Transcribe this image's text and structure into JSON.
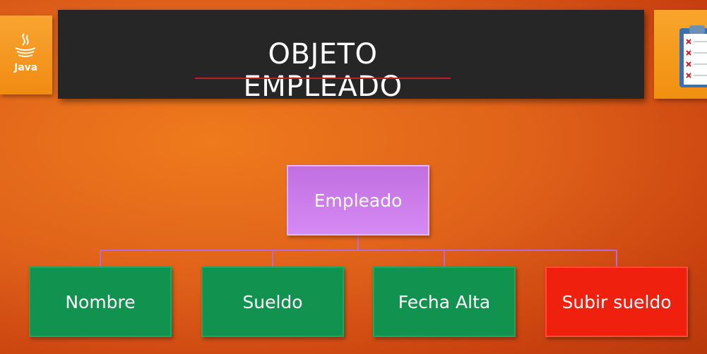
{
  "slide": {
    "title": "OBJETO EMPLEADO",
    "logo_text": "Java",
    "logo_icon": "java-cup-icon",
    "clipboard_icon": "clipboard-checklist-icon"
  },
  "diagram": {
    "root": {
      "label": "Empleado",
      "color": "#d08af0"
    },
    "children": [
      {
        "label": "Nombre",
        "color": "#11924f"
      },
      {
        "label": "Sueldo",
        "color": "#11924f"
      },
      {
        "label": "Fecha Alta",
        "color": "#11924f"
      },
      {
        "label": "Subir sueldo",
        "color": "#f0200f"
      }
    ]
  },
  "colors": {
    "banner": "#262626",
    "accent_rule": "#c0201c",
    "connector": "#b86ad0"
  }
}
